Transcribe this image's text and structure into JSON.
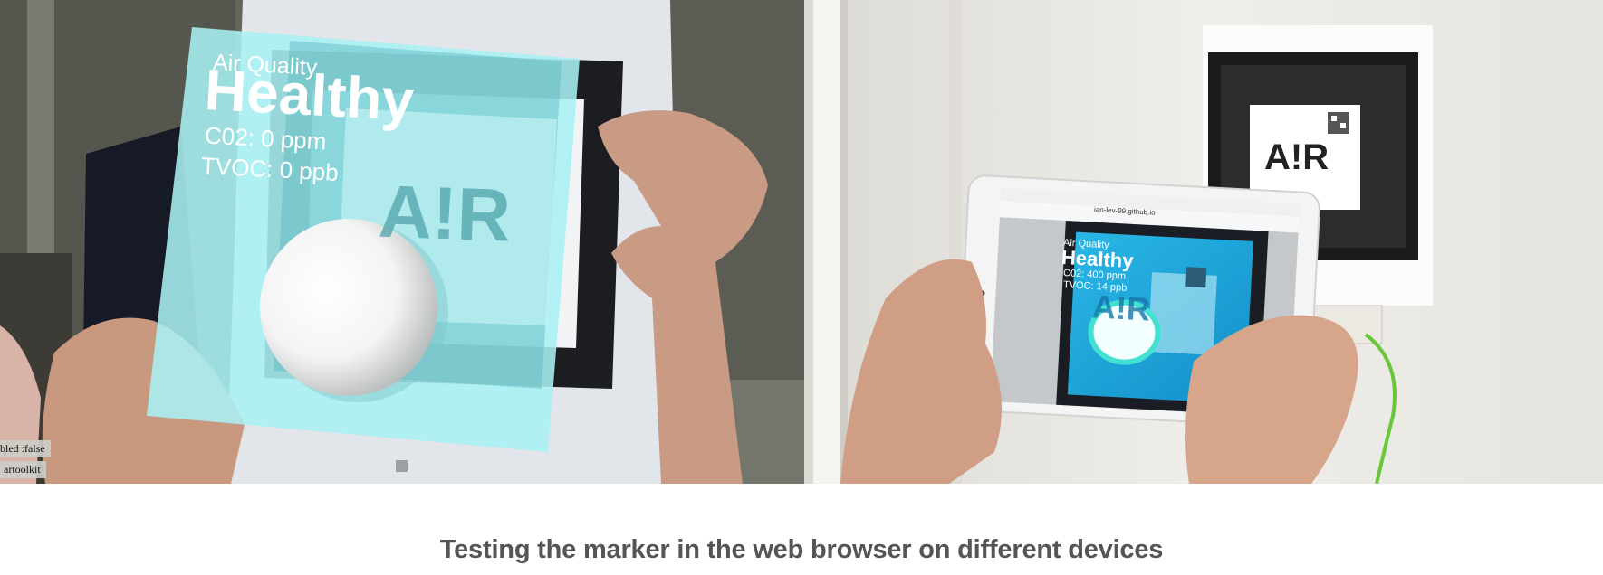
{
  "figure": {
    "caption": "Testing the marker in the web browser on different devices"
  },
  "left_photo": {
    "overlay_title": "Air Quality",
    "overlay_status": "Healthy",
    "overlay_co2": "C02: 0 ppm",
    "overlay_tvoc": "TVOC: 0 ppb",
    "marker_logo": "A!R",
    "debug_enabled": "bled :false",
    "debug_tracker": "artoolkit"
  },
  "right_photo": {
    "wall_marker_logo": "A!R",
    "tablet_url": "ian-lev-99.github.io",
    "overlay_title": "Air Quality",
    "overlay_status": "Healthy",
    "overlay_co2": "C02: 400 ppm",
    "overlay_tvoc": "TVOC: 14 ppb",
    "screen_marker_logo": "A!R"
  }
}
